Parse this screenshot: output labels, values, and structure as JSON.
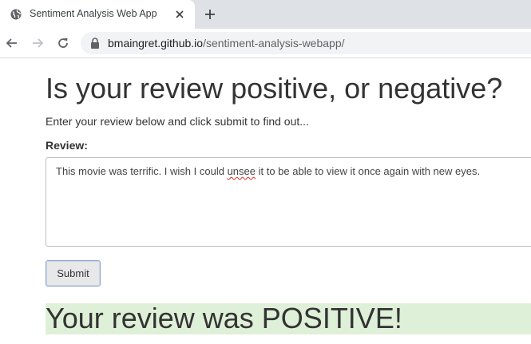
{
  "browser": {
    "tab_title": "Sentiment Analysis Web App",
    "url_domain": "bmaingret.github.io",
    "url_path": "/sentiment-analysis-webapp/",
    "icons": [
      "globe-icon",
      "close-icon",
      "plus-icon",
      "back-arrow-icon",
      "forward-arrow-icon",
      "reload-icon",
      "lock-icon"
    ]
  },
  "page": {
    "heading": "Is your review positive, or negative?",
    "intro": "Enter your review below and click submit to find out...",
    "review_label": "Review:",
    "review_text_before": "This movie was terrific. I wish I could ",
    "review_text_misspelled": "unsee",
    "review_text_after": " it to be able to view it once again with new eyes.",
    "submit_label": "Submit",
    "result": "Your review was POSITIVE!",
    "result_color": "#dff0d8"
  }
}
